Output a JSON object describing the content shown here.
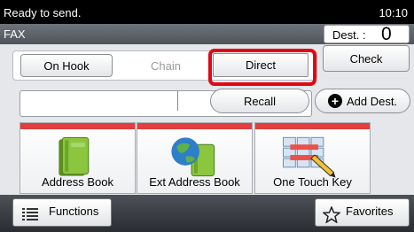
{
  "status": {
    "message": "Ready to send.",
    "time": "10:10"
  },
  "header": {
    "title": "FAX",
    "dest_label": "Dest. :",
    "dest_count": "0"
  },
  "tabs": [
    {
      "label": "On Hook"
    },
    {
      "label": "Chain"
    },
    {
      "label": "Direct"
    }
  ],
  "buttons": {
    "check": "Check",
    "recall": "Recall",
    "add_dest": "Add Dest."
  },
  "tiles": [
    {
      "label": "Address Book"
    },
    {
      "label": "Ext Address Book"
    },
    {
      "label": "One Touch Key"
    }
  ],
  "footer": {
    "functions": "Functions",
    "favorites": "Favorites"
  },
  "colors": {
    "highlight": "#e30613",
    "tile_accent": "#e33d3d"
  }
}
